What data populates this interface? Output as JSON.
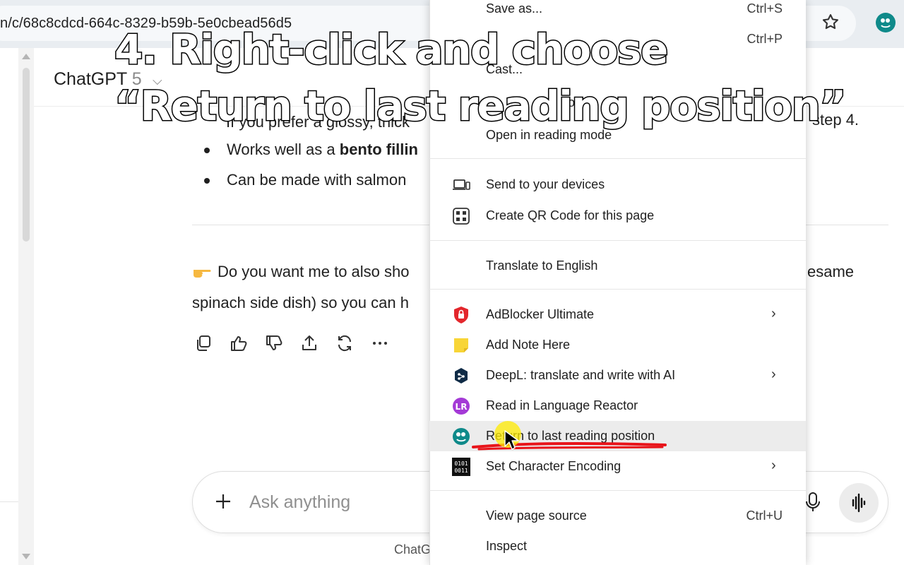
{
  "browser": {
    "url": "n/c/68c8cdcd-664c-8329-b59b-5e0cbead56d5",
    "bookmark_icon": "star-icon",
    "extension_icon": "extension-icon"
  },
  "app": {
    "model_label": "ChatGPT",
    "model_version": "5",
    "model_chevron": "⌵"
  },
  "chat": {
    "fragment_line": "If you prefer a glossy, thick",
    "step_tail": "step 4.",
    "bullets": [
      {
        "pre": "Works well as a ",
        "bold": "bento fillin"
      },
      {
        "pre": "Can be made with salmon",
        "bold": ""
      }
    ],
    "paragraph_line1": "Do you want me to also sho",
    "paragraph_line1_tail": "esame",
    "paragraph_line2": "spinach side dish) so you can h",
    "actions": [
      "copy-icon",
      "thumbs-up-icon",
      "thumbs-down-icon",
      "share-icon",
      "regenerate-icon",
      "more-icon"
    ]
  },
  "composer": {
    "placeholder": "Ask anything",
    "footer": "ChatG"
  },
  "context_menu": {
    "save_as": {
      "label": "Save as...",
      "shortcut": "Ctrl+S"
    },
    "print": {
      "shortcut": "Ctrl+P"
    },
    "cast": {
      "label": "Cast..."
    },
    "search_frag": {
      "label": "oo"
    },
    "reading_mode": {
      "label": "Open in reading mode"
    },
    "send_devices": {
      "label": "Send to your devices"
    },
    "qr_code": {
      "label": "Create QR Code for this page"
    },
    "translate": {
      "label": "Translate to English"
    },
    "adblocker": {
      "label": "AdBlocker Ultimate"
    },
    "add_note": {
      "label": "Add Note Here"
    },
    "deepl": {
      "label": "DeepL: translate and write with AI"
    },
    "language_reactor": {
      "label": "Read in Language Reactor"
    },
    "return_reading": {
      "label": "Return to last reading position"
    },
    "encoding": {
      "label": "Set Character Encoding"
    },
    "view_source": {
      "label": "View page source",
      "shortcut": "Ctrl+U"
    },
    "inspect": {
      "label": "Inspect"
    }
  },
  "overlay": {
    "line1": "4. Right-click and choose",
    "line2": "“Return to last reading position”"
  },
  "colors": {
    "highlight_underline": "#e8141a",
    "cursor_glow": "#ffeb00",
    "adblocker_red": "#e3262c",
    "note_yellow": "#f8d537",
    "deepl_navy": "#0f2b46",
    "language_reactor_purple": "#a43ad6",
    "extension_teal": "#0f8a8a"
  }
}
